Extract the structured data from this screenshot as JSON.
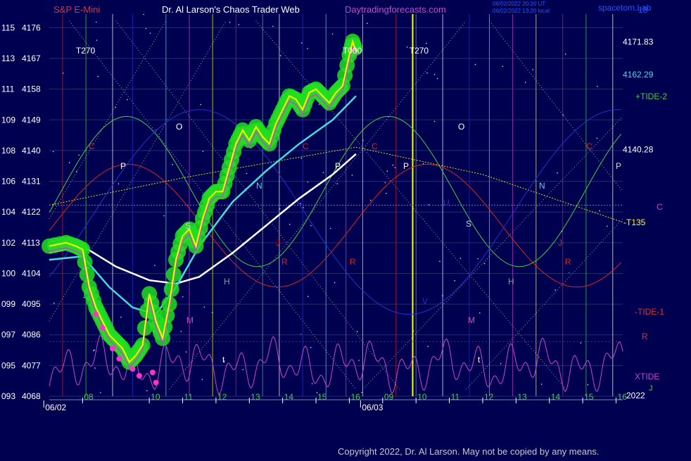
{
  "header": {
    "symbol": "S&P E-Mini",
    "author": "Dr. Al Larson's Chaos Trader Web",
    "site": "Daytradingforecasts.com",
    "stamp_line1": "06/02/2022 20:20 UT",
    "stamp_line2": "06/02/2022 13:20 local",
    "brand": "spacetom.Lab",
    "brand_suffix": "18"
  },
  "copyright": "Copyright 2022, Dr. Al Larson. May not be copied by any means.",
  "colors": {
    "background": "#000050",
    "price": "#ffff00",
    "bubble": "#22dd22",
    "slow_avg": "#ffffff",
    "mid_avg": "#44dddd",
    "tide": "#cc44cc",
    "red_line": "#dd2222",
    "green_line": "#44cc44",
    "blue_line": "#2233cc",
    "diag": "#c8c8c8",
    "curve": "#e0e000",
    "hline": "#cc44cc"
  },
  "chart_data": {
    "type": "line",
    "title": "S&P E-Mini",
    "ylim": [
      4068,
      4180
    ],
    "price_ticks": [
      4176,
      4167,
      4158,
      4149,
      4140,
      4131,
      4122,
      4113,
      4104,
      4095,
      4086,
      4077,
      4068
    ],
    "index_ticks": [
      "115",
      "113",
      "111",
      "109",
      "108",
      "106",
      "104",
      "102",
      "100",
      "099",
      "097",
      "095",
      "093"
    ],
    "x_ticks": [
      {
        "label": "08",
        "t": 8
      },
      {
        "label": "10",
        "t": 10
      },
      {
        "label": "11",
        "t": 11
      },
      {
        "label": "12",
        "t": 12
      },
      {
        "label": "13",
        "t": 13
      },
      {
        "label": "14",
        "t": 14
      },
      {
        "label": "15",
        "t": 15
      },
      {
        "label": "16",
        "t": 16
      },
      {
        "label": "09",
        "t": 17
      },
      {
        "label": "10",
        "t": 18
      },
      {
        "label": "11",
        "t": 19
      },
      {
        "label": "12",
        "t": 20
      },
      {
        "label": "13",
        "t": 21
      },
      {
        "label": "14",
        "t": 22
      },
      {
        "label": "15",
        "t": 23
      },
      {
        "label": "16",
        "t": 24
      }
    ],
    "date_labels": [
      {
        "label": "06/02",
        "t": 7.3
      },
      {
        "label": "06/03",
        "t": 16.8
      }
    ],
    "price_series": {
      "name": "S&P E-Mini",
      "points": [
        [
          7,
          4112
        ],
        [
          7.5,
          4113
        ],
        [
          7.8,
          4112
        ],
        [
          8,
          4111
        ],
        [
          8.2,
          4100
        ],
        [
          8.4,
          4094
        ],
        [
          8.6,
          4090
        ],
        [
          8.8,
          4086
        ],
        [
          9.0,
          4084
        ],
        [
          9.2,
          4082
        ],
        [
          9.4,
          4078
        ],
        [
          9.6,
          4080
        ],
        [
          9.8,
          4083
        ],
        [
          10.0,
          4098
        ],
        [
          10.2,
          4090
        ],
        [
          10.4,
          4085
        ],
        [
          10.6,
          4095
        ],
        [
          10.8,
          4108
        ],
        [
          11.0,
          4115
        ],
        [
          11.2,
          4117
        ],
        [
          11.4,
          4112
        ],
        [
          11.6,
          4120
        ],
        [
          11.8,
          4126
        ],
        [
          12.0,
          4128
        ],
        [
          12.2,
          4128
        ],
        [
          12.4,
          4135
        ],
        [
          12.6,
          4142
        ],
        [
          12.8,
          4146
        ],
        [
          13.0,
          4143
        ],
        [
          13.2,
          4147
        ],
        [
          13.4,
          4144
        ],
        [
          13.6,
          4142
        ],
        [
          13.8,
          4148
        ],
        [
          14.0,
          4152
        ],
        [
          14.2,
          4156
        ],
        [
          14.4,
          4155
        ],
        [
          14.6,
          4152
        ],
        [
          14.8,
          4157
        ],
        [
          15.0,
          4158
        ],
        [
          15.2,
          4156
        ],
        [
          15.4,
          4154
        ],
        [
          15.6,
          4157
        ],
        [
          15.8,
          4159
        ],
        [
          16.0,
          4168
        ],
        [
          16.1,
          4172
        ],
        [
          16.2,
          4169
        ]
      ]
    },
    "white_avg": {
      "name": "slow average",
      "points": [
        [
          7,
          4110
        ],
        [
          8,
          4112
        ],
        [
          9,
          4106
        ],
        [
          10,
          4102
        ],
        [
          10.8,
          4101
        ],
        [
          11.5,
          4103
        ],
        [
          12.5,
          4110
        ],
        [
          13.5,
          4118
        ],
        [
          14.5,
          4126
        ],
        [
          15.5,
          4133
        ],
        [
          16.2,
          4139
        ]
      ]
    },
    "cyan_avg": {
      "name": "fast average",
      "points": [
        [
          7,
          4108
        ],
        [
          8,
          4109
        ],
        [
          8.8,
          4100
        ],
        [
          9.5,
          4094
        ],
        [
          10.2,
          4092
        ],
        [
          10.8,
          4100
        ],
        [
          11.5,
          4112
        ],
        [
          12.5,
          4125
        ],
        [
          13.5,
          4134
        ],
        [
          14.5,
          4142
        ],
        [
          15.5,
          4149
        ],
        [
          16.2,
          4156
        ]
      ]
    },
    "right_levels": [
      {
        "label": "4171.83",
        "price": 4171.83
      },
      {
        "label": "4162.29",
        "price": 4162.29
      },
      {
        "label": "4140.28",
        "price": 4140.28
      }
    ],
    "right_labels": [
      "+TIDE-2",
      "-T135",
      "-TIDE-1",
      "XTIDE",
      "2022",
      "C",
      "R",
      "J",
      "P"
    ],
    "phase_markers": [
      "T270",
      "T000",
      "T270"
    ],
    "grid_letters": [
      "O",
      "P",
      "C",
      "N",
      "S",
      "J",
      "R",
      "H",
      "M",
      "t",
      "U",
      "V"
    ]
  }
}
